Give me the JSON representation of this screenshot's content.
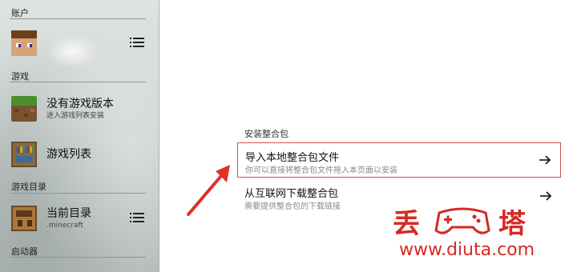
{
  "sidebar": {
    "sections": {
      "account": "账户",
      "game": "游戏",
      "game_dir": "游戏目录",
      "launcher": "启动器"
    },
    "items": {
      "game_version": {
        "title": "没有游戏版本",
        "subtitle": "进入游戏列表安装"
      },
      "game_list": {
        "title": "游戏列表"
      },
      "current_dir": {
        "title": "当前目录",
        "subtitle": ".minecraft"
      }
    }
  },
  "main": {
    "section_label": "安装整合包",
    "options": [
      {
        "title": "导入本地整合包文件",
        "subtitle": "你可以直接将整合包文件拖入本页面以安装",
        "arrow": "→"
      },
      {
        "title": "从互联网下载整合包",
        "subtitle": "需要提供整合包的下载链接",
        "arrow": "→"
      }
    ]
  },
  "watermark": {
    "chars": [
      "丢",
      "塔"
    ],
    "url": "www.diuta.com",
    "color": "#d42a22"
  },
  "colors": {
    "selected_border": "#d9534f",
    "annotation_arrow": "#e0302a"
  },
  "icons": [
    "menu-icon",
    "arrow-right-icon",
    "gamepad-icon",
    "grass-block-icon",
    "bookshelf-icon",
    "crafting-table-icon",
    "avatar"
  ]
}
